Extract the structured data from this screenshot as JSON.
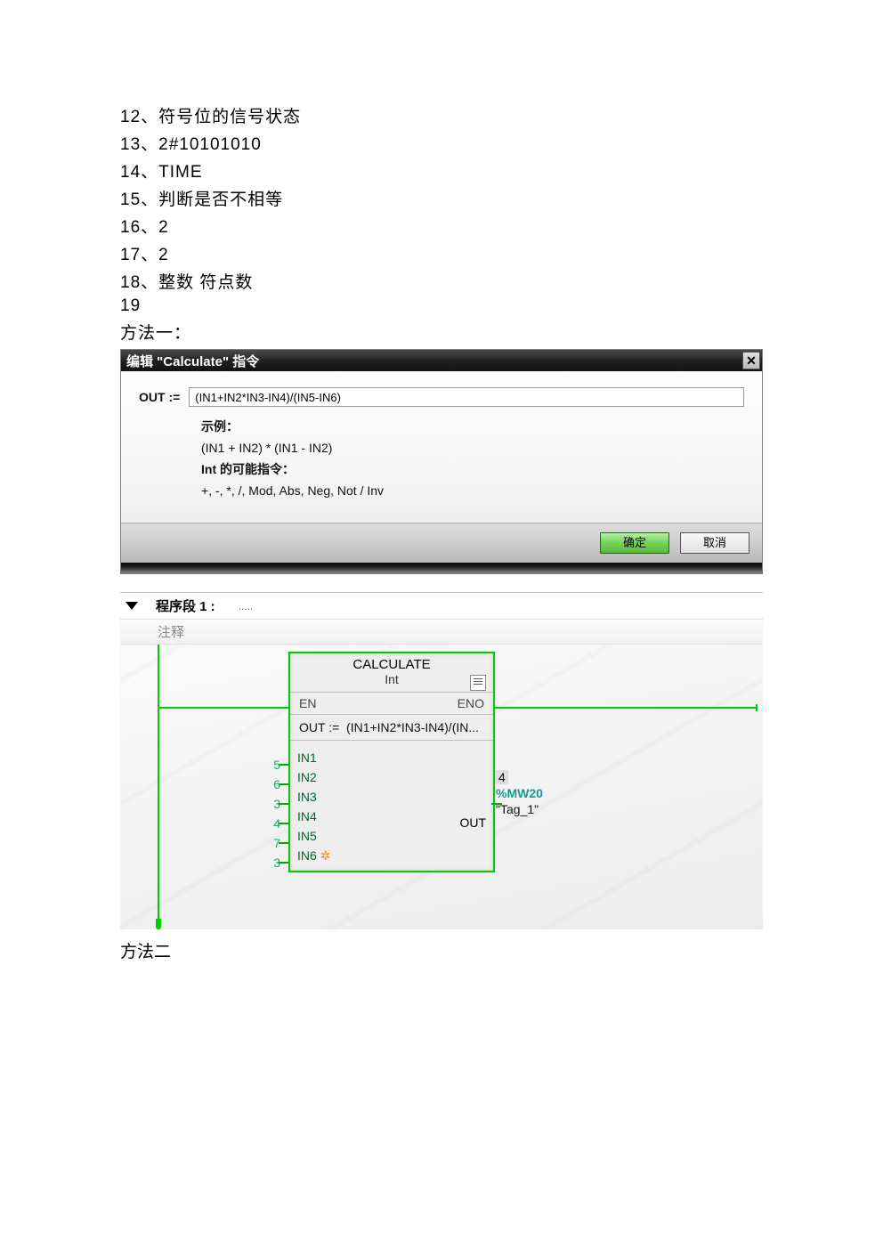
{
  "answers": {
    "i12": "12、符号位的信号状态",
    "i13": "13、2#10101010",
    "i14": "14、TIME",
    "i15": "15、判断是否不相等",
    "i16": "16、2",
    "i17": "17、2",
    "i18": "18、整数  符点数",
    "i19": "19",
    "method1": "方法一："
  },
  "dialog": {
    "title": "编辑 \"Calculate\" 指令",
    "out_label": "OUT :=",
    "out_value": "(IN1+IN2*IN3-IN4)/(IN5-IN6)",
    "hints": {
      "example_label": "示例：",
      "example_expr": "(IN1 + IN2) * (IN1 - IN2)",
      "possible_label": "Int 的可能指令：",
      "possible_ops": "+, -, *, /, Mod, Abs, Neg, Not / Inv"
    },
    "ok": "确定",
    "cancel": "取消"
  },
  "network": {
    "title": "程序段 1 :",
    "comment": "注释",
    "block": {
      "name": "CALCULATE",
      "type": "Int",
      "en": "EN",
      "eno": "ENO",
      "expr_label": "OUT :=",
      "expr": "(IN1+IN2*IN3-IN4)/(IN...",
      "pins": {
        "in1_const": "5",
        "in1": "IN1",
        "in2_const": "6",
        "in2": "IN2",
        "in3_const": "3",
        "in3": "IN3",
        "in4_const": "4",
        "in4": "IN4",
        "in5_const": "7",
        "in5": "IN5",
        "in6_const": "3",
        "in6": "IN6",
        "out": "OUT"
      },
      "output": {
        "result": "4",
        "addr": "%MW20",
        "tag": "\"Tag_1\""
      }
    }
  },
  "method2": "方法二"
}
